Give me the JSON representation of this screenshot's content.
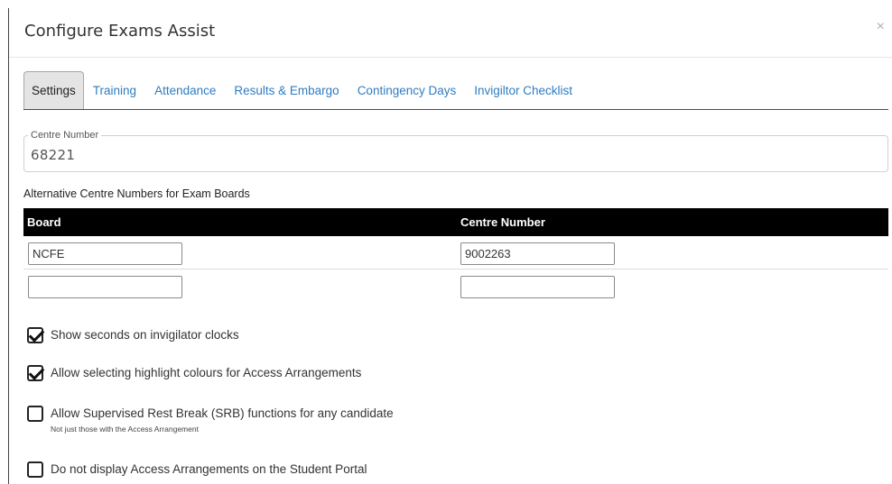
{
  "modal": {
    "title": "Configure Exams Assist",
    "close_label": "×"
  },
  "tabs": [
    {
      "label": "Settings",
      "active": true
    },
    {
      "label": "Training",
      "active": false
    },
    {
      "label": "Attendance",
      "active": false
    },
    {
      "label": "Results & Embargo",
      "active": false
    },
    {
      "label": "Contingency Days",
      "active": false
    },
    {
      "label": "Invigiltor Checklist",
      "active": false
    }
  ],
  "centre_number": {
    "label": "Centre Number",
    "value": "68221"
  },
  "alt_centres": {
    "heading": "Alternative Centre Numbers for Exam Boards",
    "columns": [
      "Board",
      "Centre Number"
    ],
    "rows": [
      {
        "board": "NCFE",
        "centre_number": "9002263"
      },
      {
        "board": "",
        "centre_number": ""
      }
    ]
  },
  "options": [
    {
      "label": "Show seconds on invigilator clocks",
      "checked": true,
      "note": ""
    },
    {
      "label": "Allow selecting highlight colours for Access Arrangements",
      "checked": true,
      "note": ""
    },
    {
      "label": "Allow Supervised Rest Break (SRB) functions for any candidate",
      "checked": false,
      "note": "Not just those with the Access Arrangement"
    },
    {
      "label": "Do not display Access Arrangements on the Student Portal",
      "checked": false,
      "note": ""
    }
  ],
  "colors": {
    "link": "#2f7cc1",
    "tab_underline": "#8b2f2f",
    "table_header_bg": "#000000",
    "active_tab_bg": "#e4e4e4"
  }
}
